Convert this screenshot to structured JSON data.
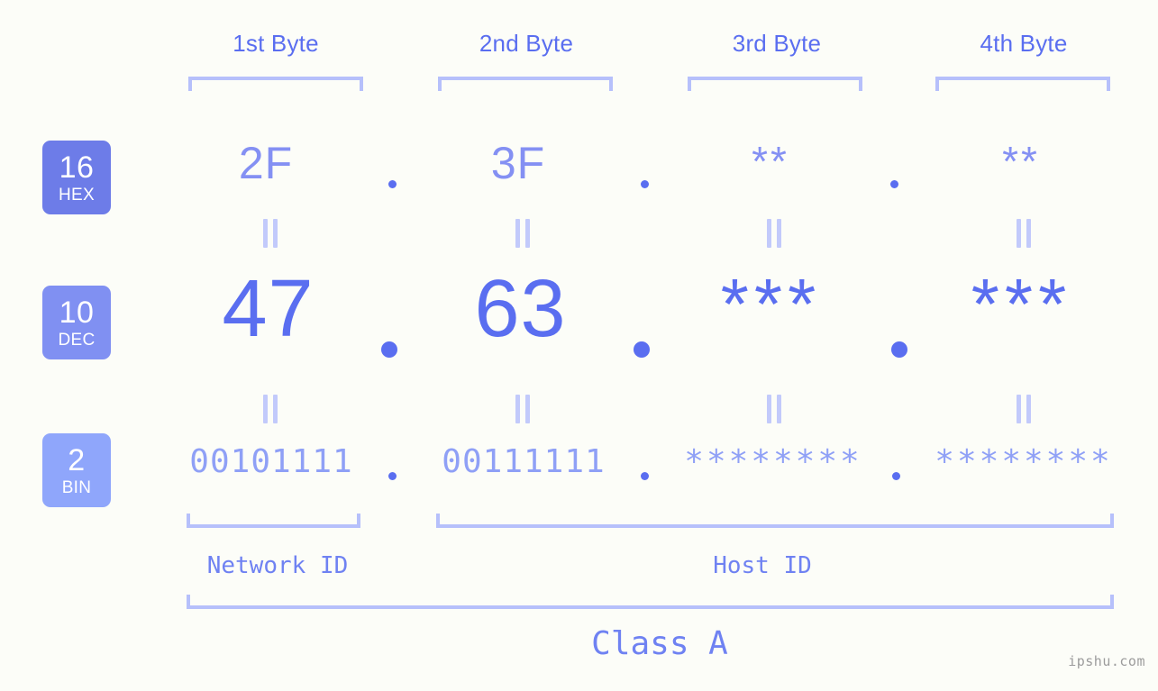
{
  "watermark": "ipshu.com",
  "columns": [
    {
      "header": "1st Byte"
    },
    {
      "header": "2nd Byte"
    },
    {
      "header": "3rd Byte"
    },
    {
      "header": "4th Byte"
    }
  ],
  "rows": [
    {
      "badge_number": "16",
      "badge_name": "HEX",
      "badge_color": "#6d7ce8",
      "values": [
        "2F",
        "3F",
        "**",
        "**"
      ]
    },
    {
      "badge_number": "10",
      "badge_name": "DEC",
      "badge_color": "#8090f2",
      "values": [
        "47",
        "63",
        "***",
        "***"
      ]
    },
    {
      "badge_number": "2",
      "badge_name": "BIN",
      "badge_color": "#8fa6fb",
      "values": [
        "00101111",
        "00111111",
        "********",
        "********"
      ]
    }
  ],
  "separators": {
    "hex": [
      ".",
      ".",
      "."
    ],
    "dec": [
      ".",
      ".",
      "."
    ],
    "bin": [
      ".",
      ".",
      "."
    ]
  },
  "sections": {
    "network_id": "Network ID",
    "host_id": "Host ID",
    "class": "Class A"
  },
  "colors": {
    "background": "#fcfdf8",
    "accent_strong": "#5a6ef0",
    "accent_mid": "#8090f2",
    "accent_light": "#b6c0fb",
    "bracket": "#b6c0fb",
    "watermark": "#9c9c9c"
  }
}
